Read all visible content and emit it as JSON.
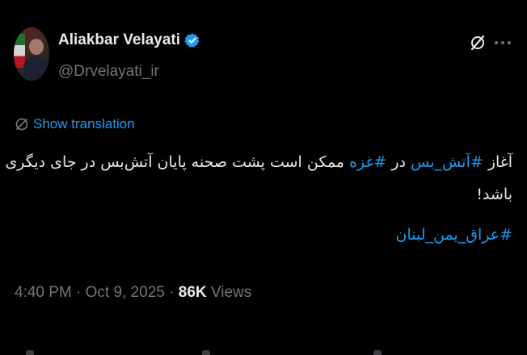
{
  "user": {
    "display_name": "Aliakbar Velayati",
    "handle": "@Drvelayati_ir",
    "verified": true
  },
  "translate": {
    "label": "Show translation"
  },
  "tweet": {
    "line1": {
      "prefix": "آغاز ",
      "hashtag1": "#آتش_بس",
      "middle": " در ",
      "hashtag2": "#غزه",
      "suffix": " ممکن است پشت صحنه پایان آتش‌بس در جای دیگری"
    },
    "line2": "باشد!",
    "line3_hashtag": "#عراق_یمن_لبنان"
  },
  "meta": {
    "timestamp": "4:40 PM · Oct 9, 2025 · ",
    "views_count": "86K",
    "views_label": " Views"
  },
  "colors": {
    "background": "#000000",
    "text_primary": "#e7e9ea",
    "text_secondary": "#71767b",
    "accent": "#1d9bf0"
  },
  "icons": {
    "verified": "verified-badge-icon",
    "grok": "grok-icon",
    "more": "more-options-icon",
    "translate": "translate-globe-icon"
  }
}
